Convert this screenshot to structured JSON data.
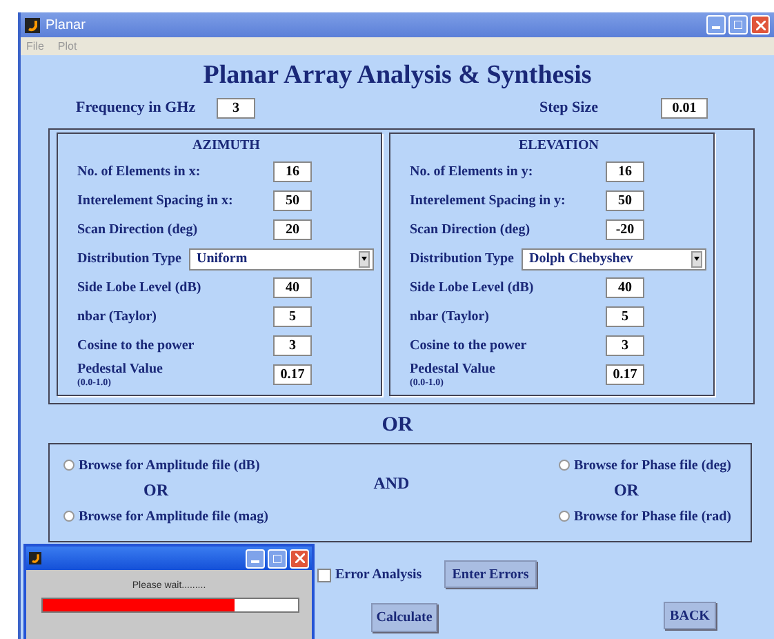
{
  "window": {
    "title": "Planar"
  },
  "menu": [
    "File",
    "Plot"
  ],
  "heading": "Planar Array Analysis & Synthesis",
  "frequency": {
    "label": "Frequency in GHz",
    "value": "3"
  },
  "step": {
    "label": "Step Size",
    "value": "0.01"
  },
  "panels": [
    {
      "title": "AZIMUTH",
      "rows": [
        {
          "kind": "field",
          "label": "No. of Elements in x:",
          "value": "16"
        },
        {
          "kind": "field",
          "label": "Interelement Spacing in x:",
          "value": "50"
        },
        {
          "kind": "field",
          "label": "Scan Direction (deg)",
          "value": "20"
        },
        {
          "kind": "dropdown",
          "label": "Distribution Type",
          "value": "Uniform"
        },
        {
          "kind": "field",
          "label": "Side Lobe Level (dB)",
          "value": "40"
        },
        {
          "kind": "field",
          "label": "nbar (Taylor)",
          "value": "5"
        },
        {
          "kind": "field",
          "label": "Cosine to the power",
          "value": "3"
        },
        {
          "kind": "field",
          "label": "Pedestal Value",
          "note": "(0.0-1.0)",
          "value": "0.17"
        }
      ]
    },
    {
      "title": "ELEVATION",
      "rows": [
        {
          "kind": "field",
          "label": "No. of Elements in y:",
          "value": "16"
        },
        {
          "kind": "field",
          "label": "Interelement Spacing in y:",
          "value": "50"
        },
        {
          "kind": "field",
          "label": "Scan Direction (deg)",
          "value": "-20"
        },
        {
          "kind": "dropdown",
          "label": "Distribution Type",
          "value": "Dolph Chebyshev"
        },
        {
          "kind": "field",
          "label": "Side Lobe Level (dB)",
          "value": "40"
        },
        {
          "kind": "field",
          "label": "nbar (Taylor)",
          "value": "5"
        },
        {
          "kind": "field",
          "label": "Cosine to the power",
          "value": "3"
        },
        {
          "kind": "field",
          "label": "Pedestal Value",
          "note": "(0.0-1.0)",
          "value": "0.17"
        }
      ]
    }
  ],
  "or_label": "OR",
  "browse": {
    "amplitude": [
      {
        "label": "Browse for Amplitude file (dB)",
        "selected": false
      },
      {
        "label": "Browse for Amplitude file (mag)",
        "selected": false
      }
    ],
    "phase": [
      {
        "label": "Browse for Phase file (deg)",
        "selected": false
      },
      {
        "label": "Browse for Phase file (rad)",
        "selected": false
      }
    ],
    "amplitude_or": "OR",
    "and": "AND",
    "phase_or": "OR"
  },
  "error_analysis": {
    "label": "Error Analysis",
    "checked": false
  },
  "buttons": {
    "enter_errors": "Enter Errors",
    "calculate": "Calculate",
    "back": "BACK"
  },
  "progress_dialog": {
    "message": "Please wait.........",
    "level": 0.75
  }
}
